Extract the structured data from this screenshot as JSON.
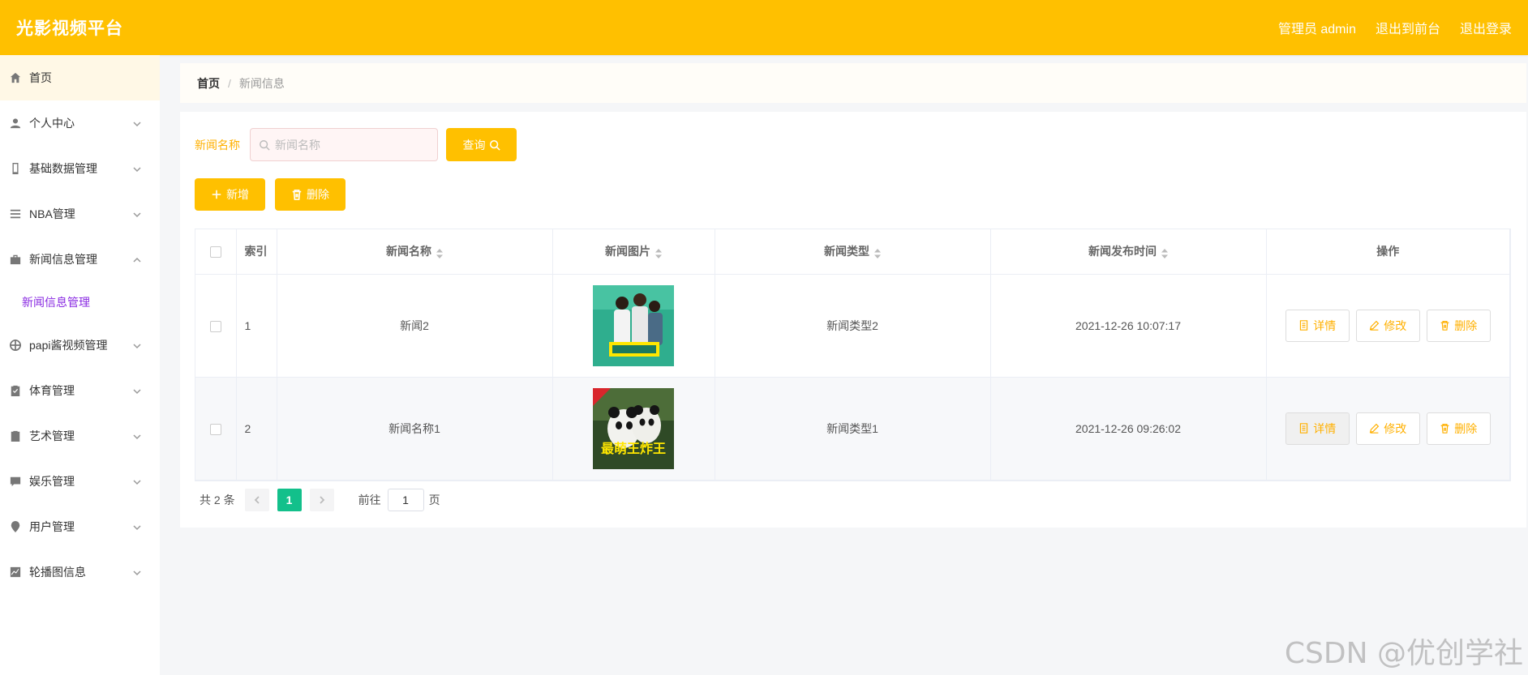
{
  "header": {
    "brand": "光影视频平台",
    "admin_label": "管理员 admin",
    "exit_front": "退出到前台",
    "logout": "退出登录",
    "accent_color": "#ffc000"
  },
  "sidebar": {
    "items": [
      {
        "label": "首页",
        "icon": "home-icon"
      },
      {
        "label": "个人中心",
        "icon": "user-icon"
      },
      {
        "label": "基础数据管理",
        "icon": "mobile-icon"
      },
      {
        "label": "NBA管理",
        "icon": "list-icon"
      },
      {
        "label": "新闻信息管理",
        "icon": "suitcase-icon"
      },
      {
        "label": "papi酱视频管理",
        "icon": "target-icon"
      },
      {
        "label": "体育管理",
        "icon": "clipboard-check-icon"
      },
      {
        "label": "艺术管理",
        "icon": "clipboard-x-icon"
      },
      {
        "label": "娱乐管理",
        "icon": "chat-icon"
      },
      {
        "label": "用户管理",
        "icon": "pin-icon"
      },
      {
        "label": "轮播图信息",
        "icon": "chart-icon"
      }
    ],
    "submenu_active": "新闻信息管理"
  },
  "breadcrumb": {
    "home": "首页",
    "separator": "/",
    "current": "新闻信息"
  },
  "search": {
    "label": "新闻名称",
    "placeholder": "新闻名称",
    "query_button": "查询"
  },
  "actions": {
    "add": "新增",
    "delete": "删除"
  },
  "table": {
    "columns": [
      "索引",
      "新闻名称",
      "新闻图片",
      "新闻类型",
      "新闻发布时间",
      "操作"
    ],
    "rows": [
      {
        "index": "1",
        "name": "新闻2",
        "type": "新闻类型2",
        "time": "2021-12-26 10:07:17"
      },
      {
        "index": "2",
        "name": "新闻名称1",
        "type": "新闻类型1",
        "time": "2021-12-26 09:26:02"
      }
    ],
    "op_detail": "详情",
    "op_edit": "修改",
    "op_delete": "删除",
    "thumb2_caption": "最萌王炸王"
  },
  "pagination": {
    "total": "共 2 条",
    "current_page": "1",
    "goto_label": "前往",
    "goto_value": "1",
    "goto_suffix": "页",
    "active_color": "#13c08b"
  },
  "watermark": "CSDN @优创学社"
}
